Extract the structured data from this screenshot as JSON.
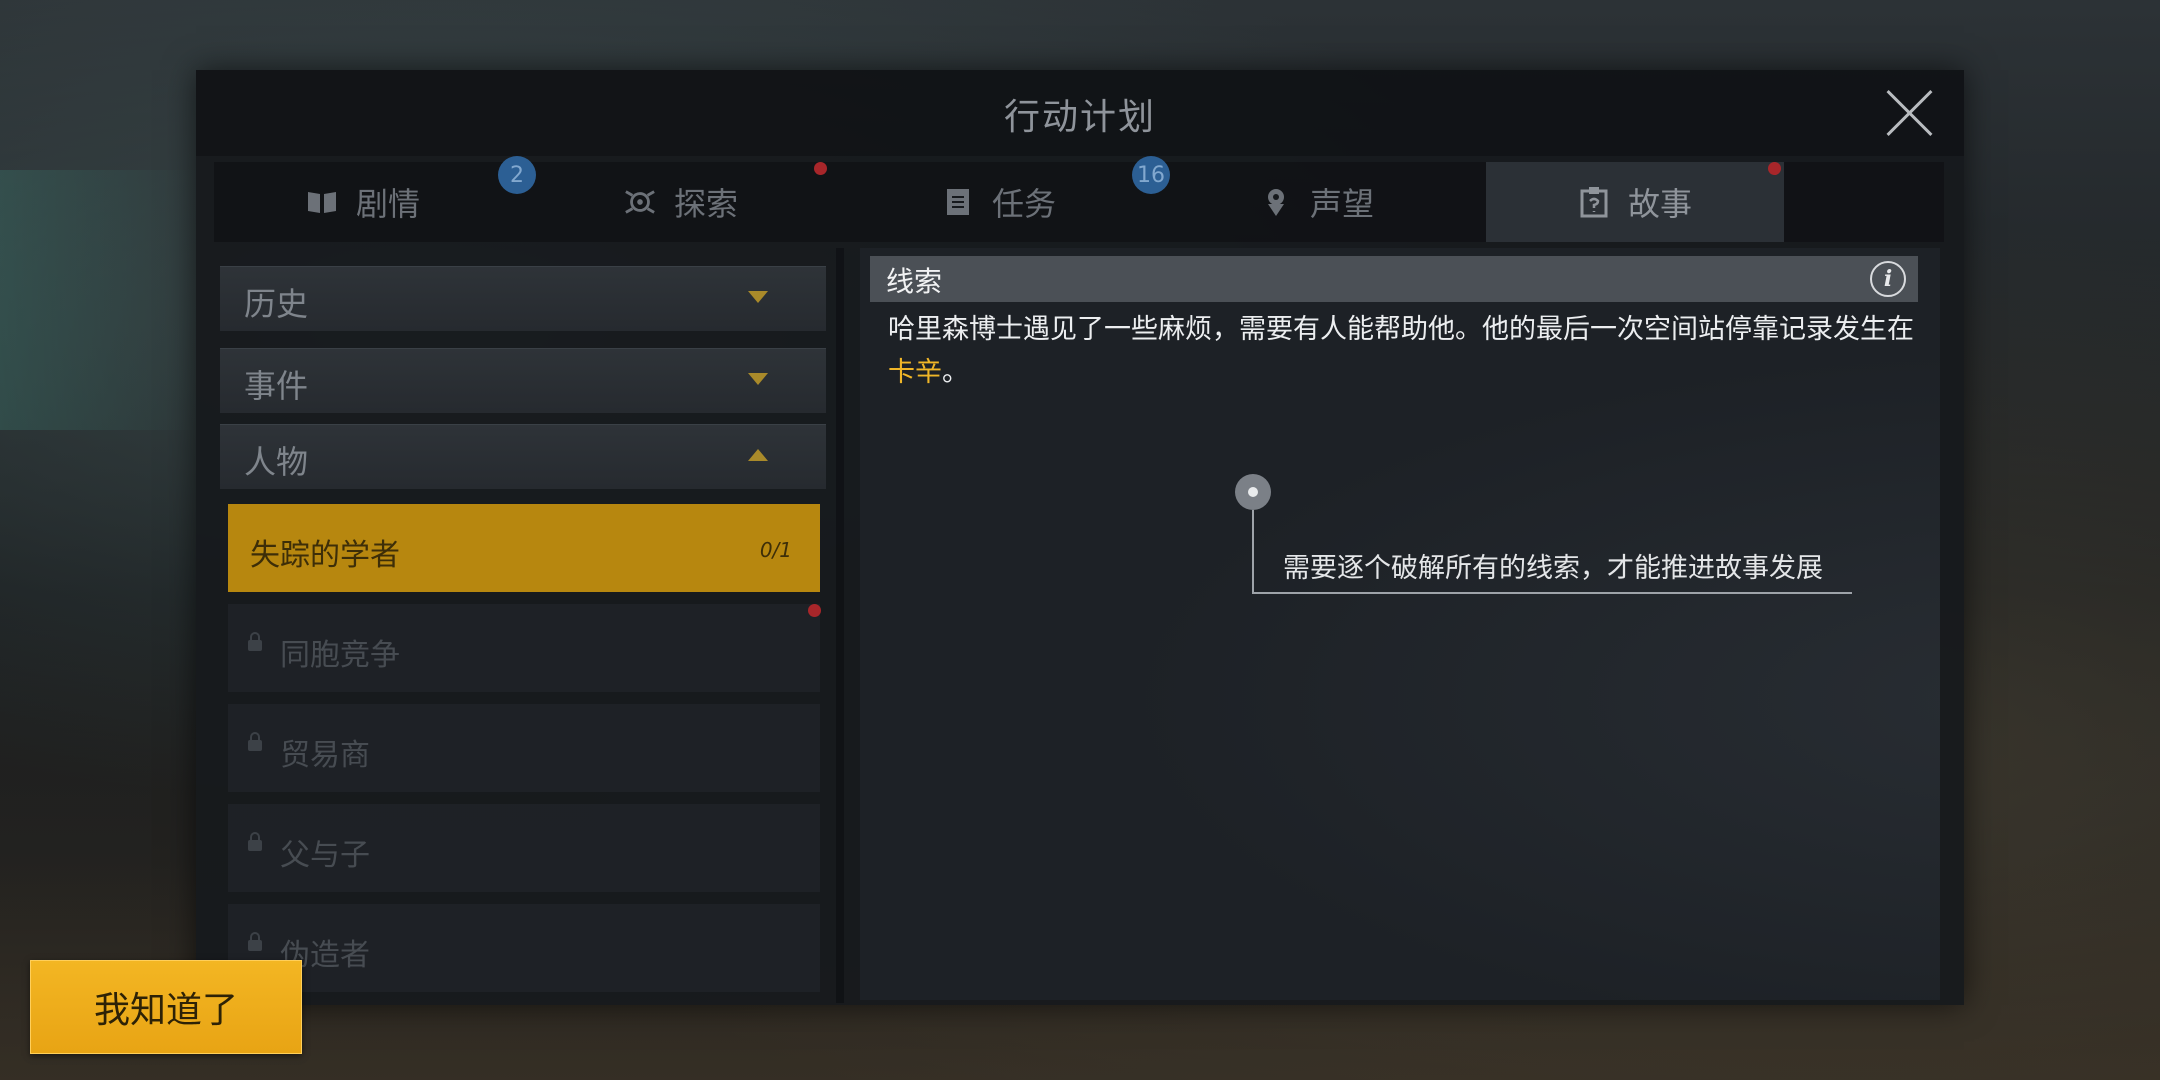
{
  "panel": {
    "title": "行动计划"
  },
  "tabs": [
    {
      "label": "剧情",
      "icon": "book-icon",
      "badge": "2",
      "active": false
    },
    {
      "label": "探索",
      "icon": "explore-icon",
      "red_dot": true,
      "active": false
    },
    {
      "label": "任务",
      "icon": "clipboard-icon",
      "badge": "16",
      "active": false
    },
    {
      "label": "声望",
      "icon": "pin-icon",
      "active": false
    },
    {
      "label": "故事",
      "icon": "story-icon",
      "red_dot": true,
      "active": true
    }
  ],
  "categories": [
    {
      "label": "历史",
      "expanded": false
    },
    {
      "label": "事件",
      "expanded": false
    },
    {
      "label": "人物",
      "expanded": true
    }
  ],
  "stories": [
    {
      "name": "失踪的学者",
      "progress": "0/1",
      "locked": false,
      "active": true
    },
    {
      "name": "同胞竞争",
      "locked": true,
      "red_dot": true
    },
    {
      "name": "贸易商",
      "locked": true
    },
    {
      "name": "父与子",
      "locked": true
    },
    {
      "name": "伪造者",
      "locked": true
    }
  ],
  "clue": {
    "title": "线索",
    "text_before": "哈里森博士遇见了一些麻烦，需要有人能帮助他。他的最后一次空间站停靠记录发生在",
    "highlight": "卡辛",
    "text_after": "。"
  },
  "tip": {
    "text": "需要逐个破解所有的线索，才能推进故事发展"
  },
  "ok_button": {
    "label": "我知道了"
  },
  "colors": {
    "accent": "#f0b628",
    "badge": "#2c5f94",
    "alert": "#a8262a"
  }
}
